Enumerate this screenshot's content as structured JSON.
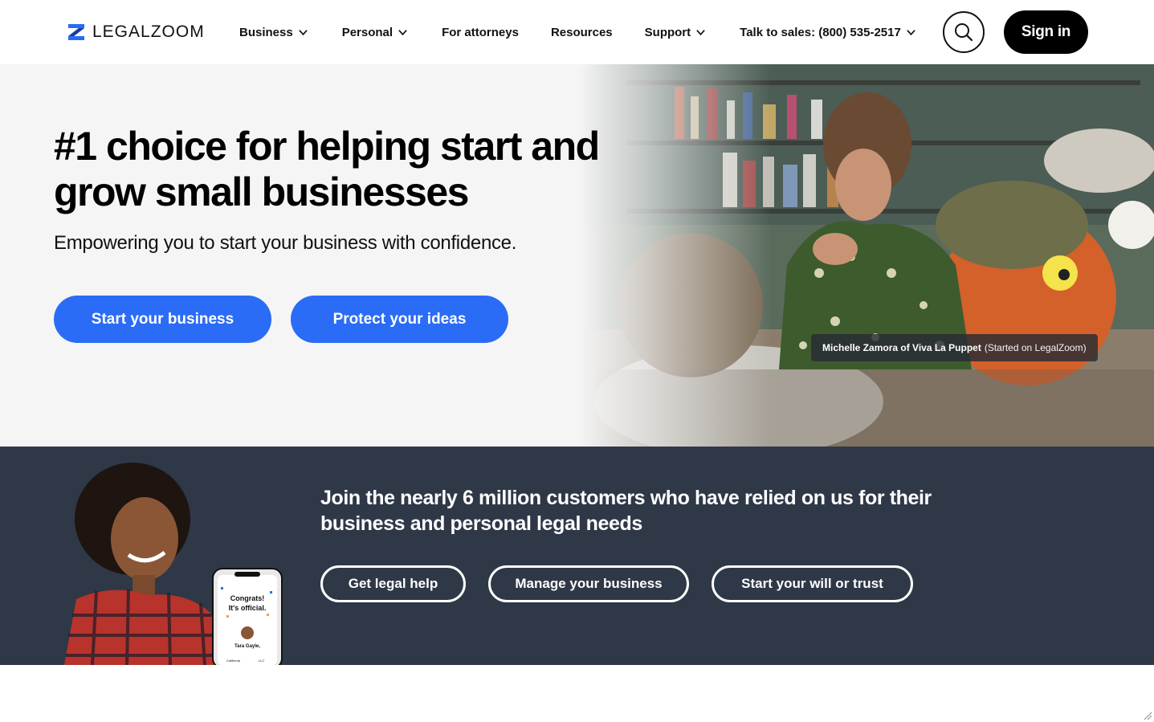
{
  "brand": {
    "name": "LEGALZOOM",
    "accent": "#2b6cf6",
    "dark_band": "#2f3847"
  },
  "nav": {
    "items": [
      {
        "label": "Business",
        "has_dropdown": true
      },
      {
        "label": "Personal",
        "has_dropdown": true
      },
      {
        "label": "For attorneys",
        "has_dropdown": false
      },
      {
        "label": "Resources",
        "has_dropdown": false
      },
      {
        "label": "Support",
        "has_dropdown": true
      },
      {
        "label": "Talk to sales: (800) 535-2517",
        "has_dropdown": true
      }
    ],
    "search_icon": "search-icon",
    "signin_label": "Sign in"
  },
  "hero": {
    "title": "#1 choice for helping start and grow small businesses",
    "subtitle": "Empowering you to start your business with confidence.",
    "primary_cta": "Start your business",
    "secondary_cta": "Protect your ideas",
    "photo_caption_name": "Michelle Zamora of Viva La Puppet",
    "photo_caption_note": "(Started on LegalZoom)"
  },
  "band": {
    "title": "Join the nearly 6 million customers who have relied on us for their business and personal legal needs",
    "buttons": [
      "Get legal help",
      "Manage your business",
      "Start your will or trust"
    ],
    "phone_text_1": "Congrats!",
    "phone_text_2": "It's official.",
    "phone_name": "Tara Gayle,",
    "phone_state": "California",
    "phone_entity": "LLC"
  }
}
